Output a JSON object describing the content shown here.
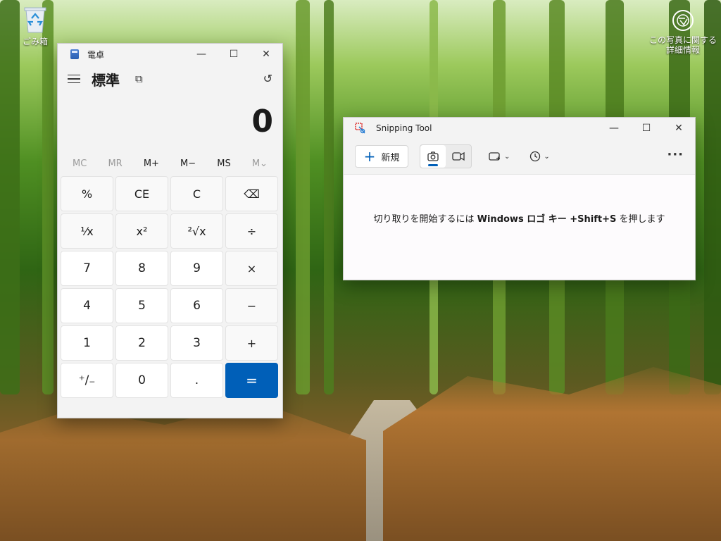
{
  "desktop": {
    "recycle_bin_label": "ごみ箱",
    "photo_info_label": "この写真に関する詳細情報"
  },
  "calculator": {
    "window_title": "電卓",
    "mode_title": "標準",
    "display_value": "0",
    "memory": [
      "MC",
      "MR",
      "M+",
      "M−",
      "MS",
      "M⌄"
    ],
    "keys": [
      {
        "label": "%",
        "type": "fn"
      },
      {
        "label": "CE",
        "type": "fn"
      },
      {
        "label": "C",
        "type": "fn"
      },
      {
        "label": "⌫",
        "type": "fn"
      },
      {
        "label": "¹⁄x",
        "type": "fn"
      },
      {
        "label": "x²",
        "type": "fn"
      },
      {
        "label": "²√x",
        "type": "fn"
      },
      {
        "label": "÷",
        "type": "fn"
      },
      {
        "label": "7",
        "type": "num"
      },
      {
        "label": "8",
        "type": "num"
      },
      {
        "label": "9",
        "type": "num"
      },
      {
        "label": "×",
        "type": "fn"
      },
      {
        "label": "4",
        "type": "num"
      },
      {
        "label": "5",
        "type": "num"
      },
      {
        "label": "6",
        "type": "num"
      },
      {
        "label": "−",
        "type": "fn"
      },
      {
        "label": "1",
        "type": "num"
      },
      {
        "label": "2",
        "type": "num"
      },
      {
        "label": "3",
        "type": "num"
      },
      {
        "label": "+",
        "type": "fn"
      },
      {
        "label": "⁺/₋",
        "type": "num"
      },
      {
        "label": "0",
        "type": "num"
      },
      {
        "label": ".",
        "type": "num"
      },
      {
        "label": "=",
        "type": "eq"
      }
    ]
  },
  "snipping_tool": {
    "window_title": "Snipping Tool",
    "new_label": "新規",
    "message_prefix": "切り取りを開始するには ",
    "message_keys": "Windows ロゴ キー +Shift+S",
    "message_suffix": " を押します"
  },
  "colors": {
    "accent": "#005fb8",
    "window_bg": "#f3f3f3"
  }
}
